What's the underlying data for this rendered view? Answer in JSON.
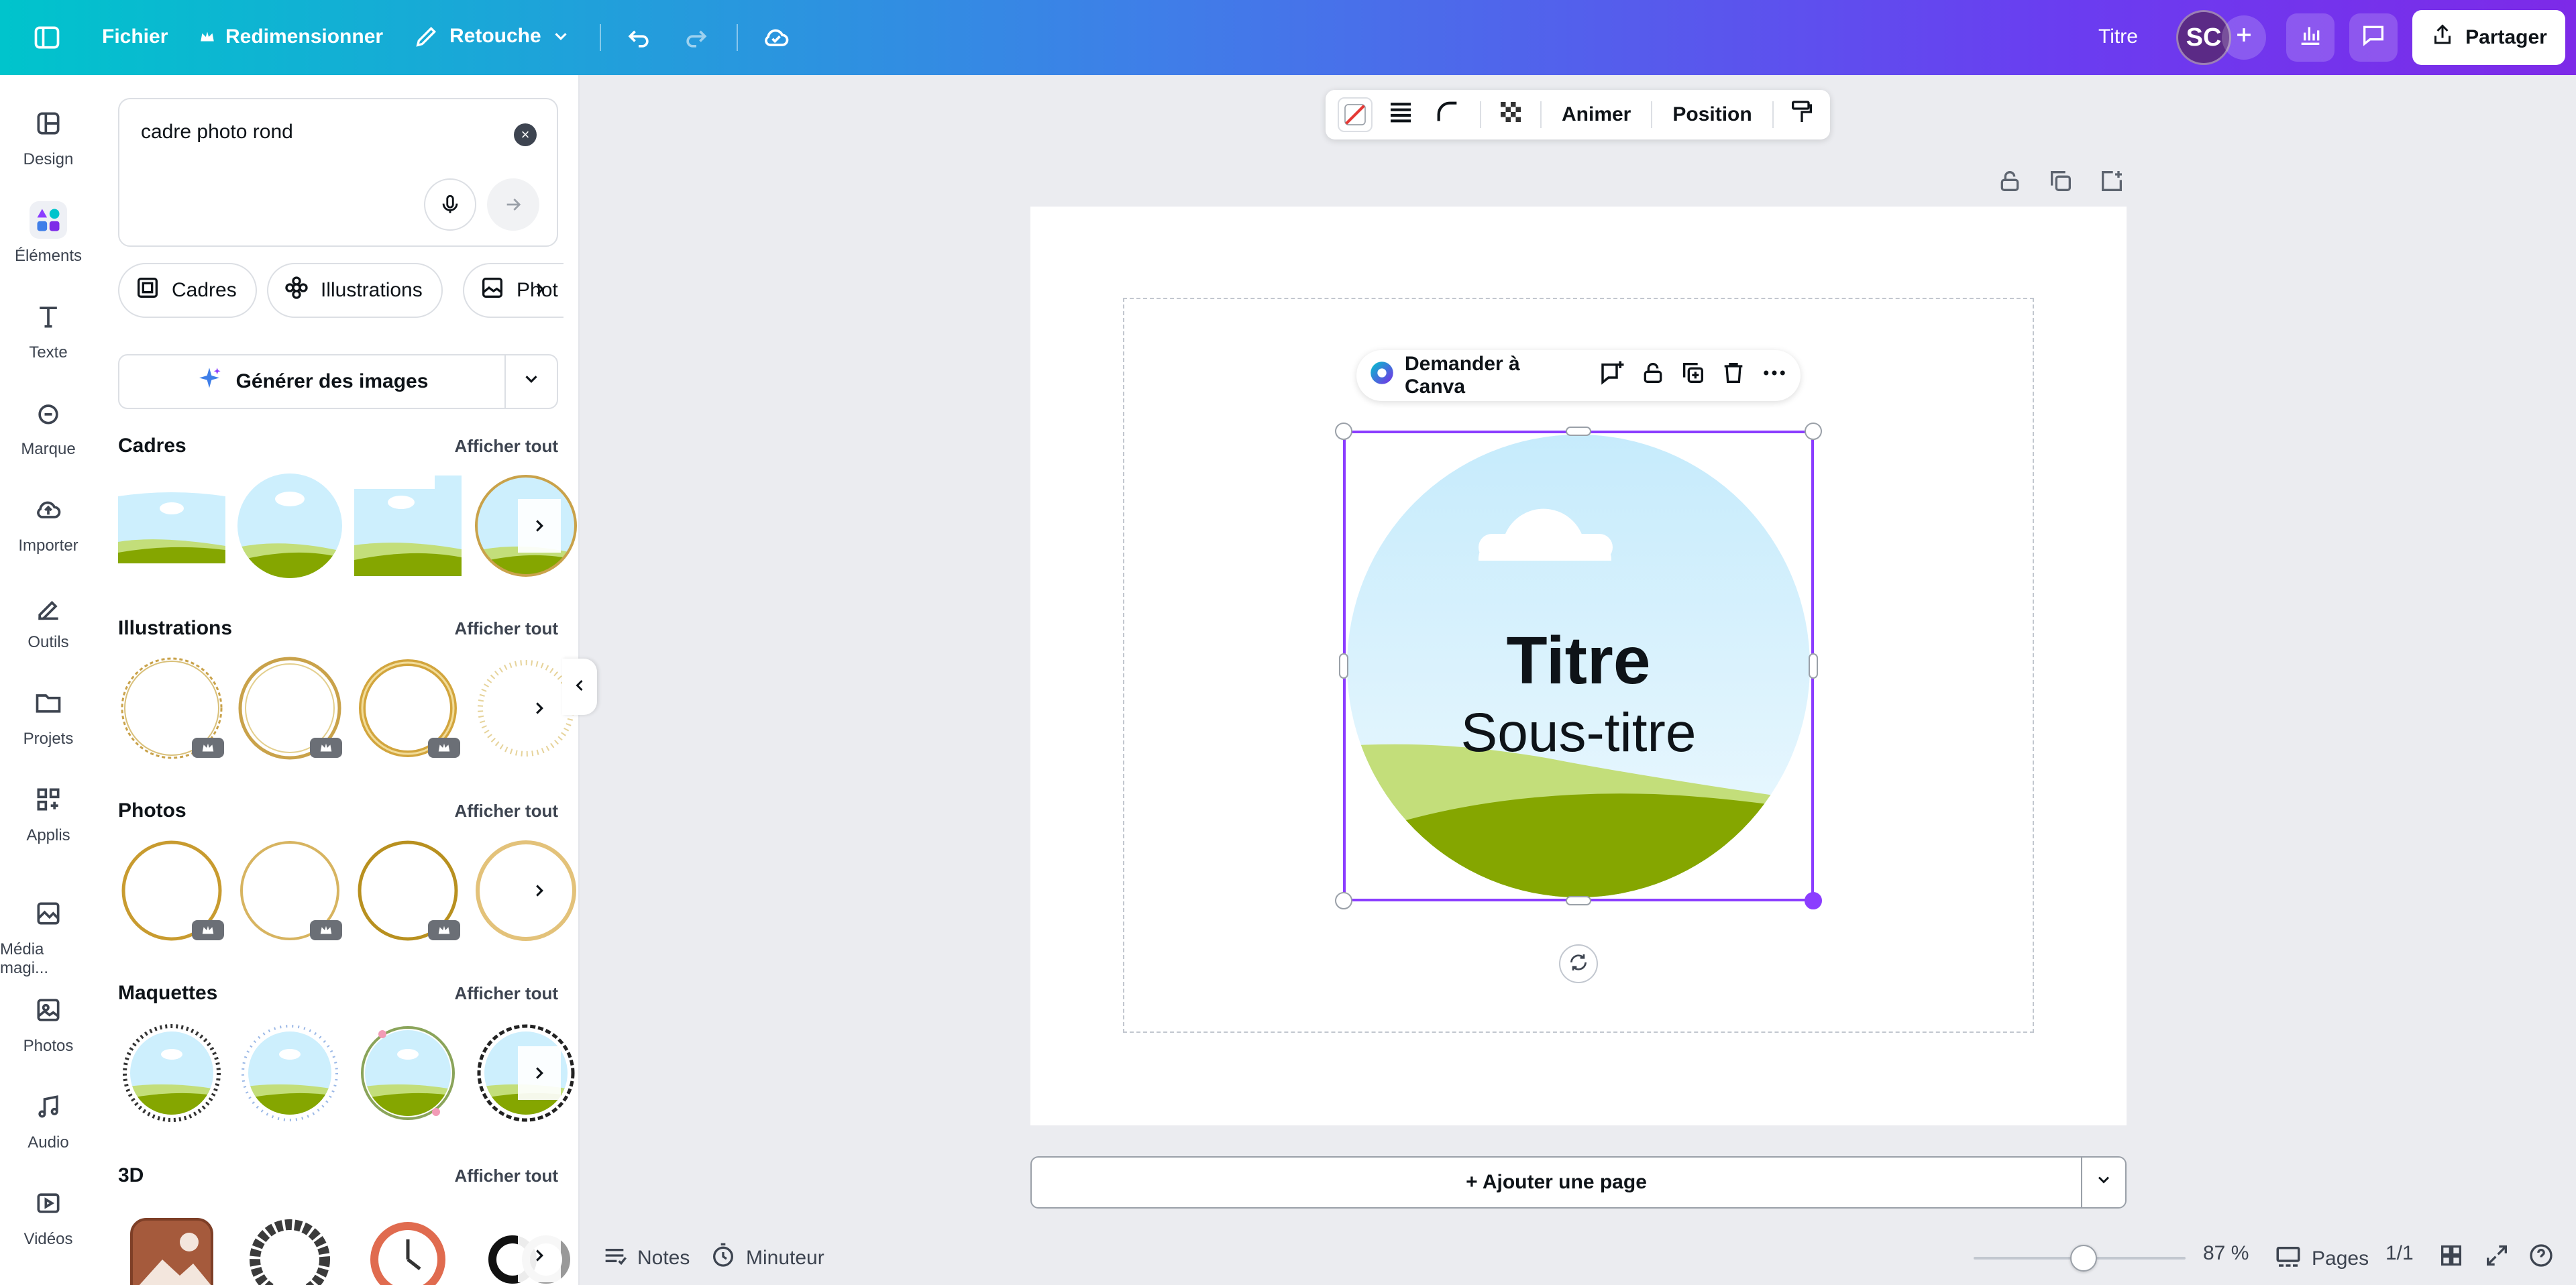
{
  "topbar": {
    "menu_file": "Fichier",
    "resize": "Redimensionner",
    "retouch": "Retouche",
    "doc_title": "Titre",
    "avatar_initials": "SC",
    "share": "Partager"
  },
  "rail": {
    "items": [
      {
        "label": "Design",
        "icon": "design-icon"
      },
      {
        "label": "Éléments",
        "icon": "elements-icon"
      },
      {
        "label": "Texte",
        "icon": "text-icon"
      },
      {
        "label": "Marque",
        "icon": "brand-icon"
      },
      {
        "label": "Importer",
        "icon": "upload-icon"
      },
      {
        "label": "Outils",
        "icon": "tools-icon"
      },
      {
        "label": "Projets",
        "icon": "folder-icon"
      },
      {
        "label": "Applis",
        "icon": "apps-icon"
      },
      {
        "label": "Média magi...",
        "icon": "magic-media-icon"
      },
      {
        "label": "Photos",
        "icon": "photos-icon"
      },
      {
        "label": "Audio",
        "icon": "audio-icon"
      },
      {
        "label": "Vidéos",
        "icon": "videos-icon"
      }
    ],
    "active": "Éléments"
  },
  "panel": {
    "search_value": "cadre photo rond",
    "chips": [
      "Cadres",
      "Illustrations",
      "Phot"
    ],
    "generate": "Générer des images",
    "see_all": "Afficher tout",
    "sections": [
      "Cadres",
      "Illustrations",
      "Photos",
      "Maquettes",
      "3D"
    ]
  },
  "context_toolbar": {
    "animate": "Animer",
    "position": "Position"
  },
  "ask_canva": "Demander à Canva",
  "canvas": {
    "title": "Titre",
    "subtitle": "Sous-titre"
  },
  "add_page": "+ Ajouter une page",
  "bottombar": {
    "notes": "Notes",
    "timer": "Minuteur",
    "zoom": "87 %",
    "zoom_fraction": 0.52,
    "pages": "Pages",
    "page_count": "1/1"
  },
  "colors": {
    "accent": "#8b3dff",
    "sky": "#cdeffd",
    "grass_light": "#c3de7a",
    "grass_dark": "#85a600"
  }
}
